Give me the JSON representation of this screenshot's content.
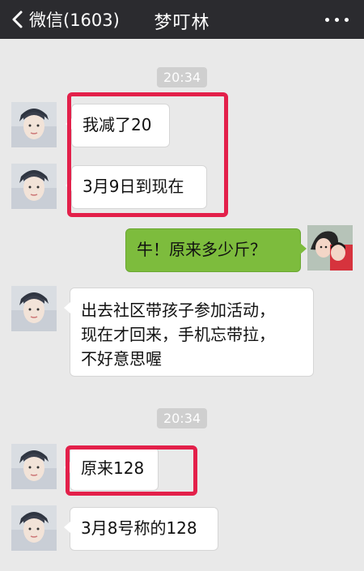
{
  "header": {
    "back_label": "微信(1603)",
    "title": "梦叮林"
  },
  "timestamps": [
    "20:34",
    "20:34"
  ],
  "messages": [
    {
      "sender": "other",
      "text": "我减了20"
    },
    {
      "sender": "other",
      "text": "3月9日到现在"
    },
    {
      "sender": "self",
      "text": "牛！原来多少斤？"
    },
    {
      "sender": "other",
      "text": "出去社区带孩子参加活动，\n现在才回来，手机忘带拉，\n不好意思喔"
    },
    {
      "sender": "other",
      "text": "原来128"
    },
    {
      "sender": "other",
      "text": "3月8号称的128"
    }
  ],
  "colors": {
    "highlight": "#e3204a",
    "self_bubble": "#7dbc3d",
    "header_bg": "#2b2b2f"
  }
}
